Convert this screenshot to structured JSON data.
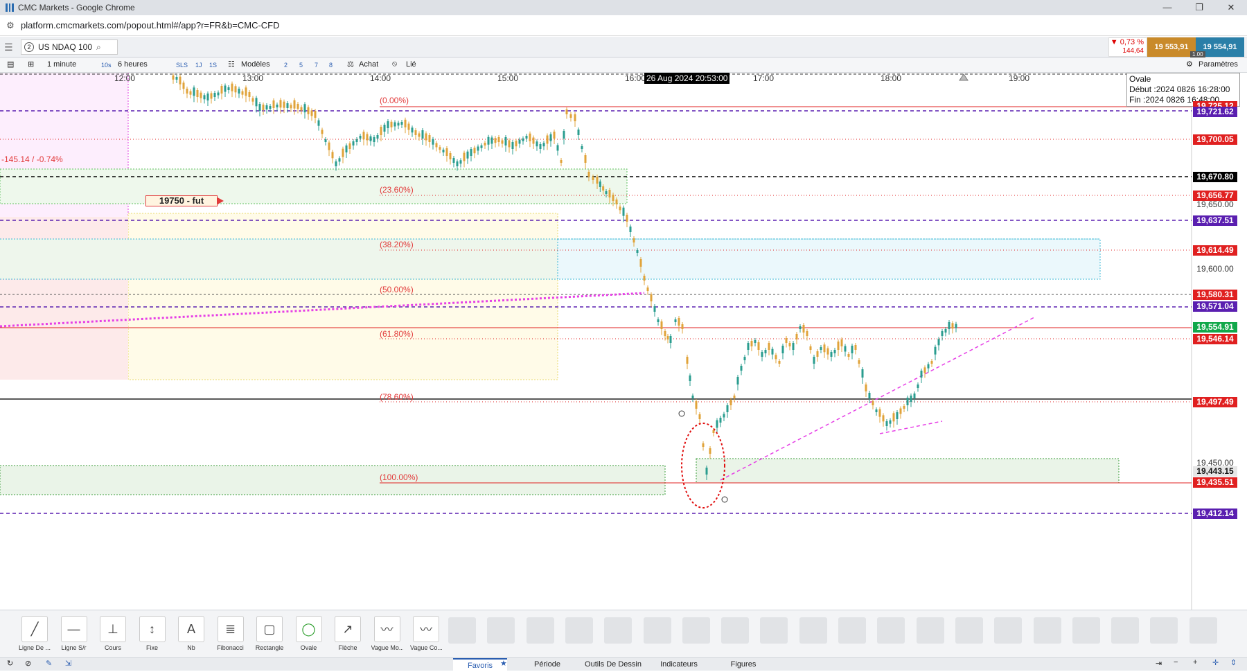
{
  "browser": {
    "window_title": "CMC Markets - Google Chrome",
    "url": "platform.cmcmarkets.com/popout.html#/app?r=FR&b=CMC-CFD"
  },
  "instrument": {
    "index": "2",
    "name": "US NDAQ 100",
    "change_pct": "▼ 0,73 %",
    "change_abs": "144,64",
    "sell": "19 553,91",
    "buy": "19 554,91",
    "spread": "1.00"
  },
  "toolbar": {
    "interval": "1 minute",
    "interval_btn": "10s",
    "range": "6 heures",
    "quick": [
      "SLS",
      "1J",
      "1S"
    ],
    "templates": "Modèles",
    "numbers": [
      "2",
      "5",
      "7",
      "8"
    ],
    "achat": "Achat",
    "lie": "Lié",
    "settings": "Paramètres"
  },
  "chart": {
    "x_labels": [
      "12:00",
      "13:00",
      "14:00",
      "15:00",
      "16:00",
      "17:00",
      "18:00",
      "19:00"
    ],
    "crosshair_time": "26 Aug 2024 20:53:00",
    "change_note": "-145.14 / -0.74%",
    "fut_label": "19750 - fut",
    "oval_info": {
      "title": "Ovale",
      "start": "Début :2024 0826 16:28:00",
      "end": "Fin :2024 0826 16:48:00"
    },
    "fib_levels": [
      "(0.00%)",
      "(23.60%)",
      "(38.20%)",
      "(50.00%)",
      "(61.80%)",
      "(78.60%)",
      "(100.00%)"
    ],
    "price_axis": [
      "19,650.00",
      "19,600.00",
      "19,450.00"
    ],
    "price_tags": [
      {
        "text": "19,725.12",
        "color": "#e02020"
      },
      {
        "text": "19,721.62",
        "color": "#5a1fb0"
      },
      {
        "text": "19,700.05",
        "color": "#e02020"
      },
      {
        "text": "19,670.80",
        "color": "#000000"
      },
      {
        "text": "19,656.77",
        "color": "#e02020"
      },
      {
        "text": "19,637.51",
        "color": "#5a1fb0"
      },
      {
        "text": "19,614.49",
        "color": "#e02020"
      },
      {
        "text": "19,580.31",
        "color": "#e02020"
      },
      {
        "text": "19,571.04",
        "color": "#5a1fb0"
      },
      {
        "text": "19,554.91",
        "color": "#11a84a"
      },
      {
        "text": "19,546.14",
        "color": "#e02020"
      },
      {
        "text": "19,497.49",
        "color": "#e02020"
      },
      {
        "text": "19,443.15",
        "color": "#e6e6e6"
      },
      {
        "text": "19,435.51",
        "color": "#e02020"
      },
      {
        "text": "19,412.14",
        "color": "#5a1fb0"
      }
    ]
  },
  "drawing_tools": [
    {
      "label": "Ligne De ...",
      "icon": "trend-line-icon"
    },
    {
      "label": "Ligne S/r",
      "icon": "sr-line-icon"
    },
    {
      "label": "Cours",
      "icon": "price-line-icon"
    },
    {
      "label": "Fixe",
      "icon": "fixed-line-icon"
    },
    {
      "label": "Nb",
      "icon": "text-icon"
    },
    {
      "label": "Fibonacci",
      "icon": "fibonacci-icon"
    },
    {
      "label": "Rectangle",
      "icon": "rectangle-icon"
    },
    {
      "label": "Ovale",
      "icon": "oval-icon"
    },
    {
      "label": "Flèche",
      "icon": "arrow-icon"
    },
    {
      "label": "Vague Mo...",
      "icon": "wave-icon"
    },
    {
      "label": "Vague Co...",
      "icon": "wave-correction-icon"
    }
  ],
  "bottom_tabs": [
    "Favoris",
    "Période",
    "Outils De Dessin",
    "Indicateurs",
    "Figures"
  ]
}
